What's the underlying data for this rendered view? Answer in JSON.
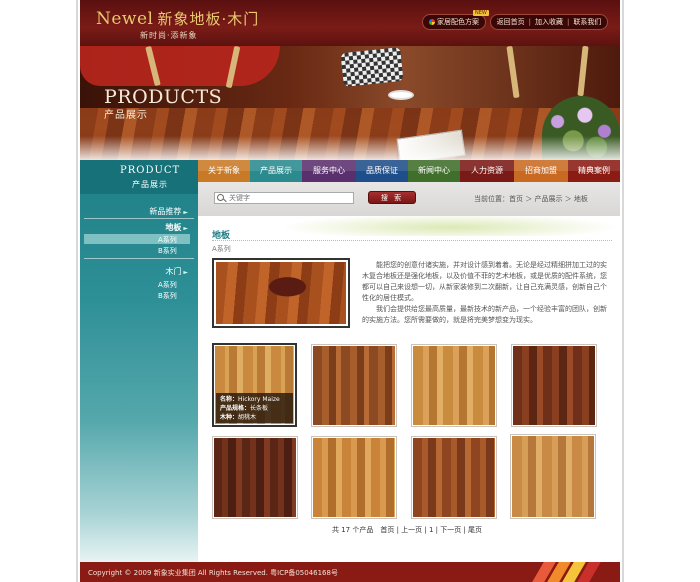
{
  "header": {
    "brand_en": "Newel",
    "brand_cn": "新象地板·木门",
    "slogan": "新时尚·添新象",
    "color_scheme_link": "家居配色方案",
    "new_badge": "NEW",
    "top_links": [
      "返回首页",
      "加入收藏",
      "联系我们"
    ]
  },
  "banner": {
    "title": "PRODUCTS",
    "subtitle": "产品展示"
  },
  "sidebar": {
    "title_en": "PRODUCT",
    "title_cn": "产品展示",
    "recommend": "新品推荐",
    "floor": "地板",
    "floor_series": [
      "A系列",
      "B系列"
    ],
    "door": "木门",
    "door_series": [
      "A系列",
      "B系列"
    ]
  },
  "nav": {
    "items": [
      {
        "label": "关于新象",
        "color": "#c97a26"
      },
      {
        "label": "产品展示",
        "color": "#2a8a8e"
      },
      {
        "label": "服务中心",
        "color": "#5a2f6e"
      },
      {
        "label": "品质保证",
        "color": "#1f4f8a"
      },
      {
        "label": "新闻中心",
        "color": "#3f6f2a"
      },
      {
        "label": "人力资源",
        "color": "#7a1a16"
      },
      {
        "label": "招商加盟",
        "color": "#c96a22"
      },
      {
        "label": "精典案例",
        "color": "#8a1c14"
      }
    ]
  },
  "search": {
    "placeholder": "关键字",
    "button": "搜 索",
    "breadcrumb": "当前位置：首页 ＞ 产品展示 ＞ 地板"
  },
  "content": {
    "section_title": "地板",
    "series": "A系列",
    "intro_p1": "　　能把您的创意付诸实施，并对设计感到着着。无论是经过精细拼加工过的实木复合地板还是强化地板，以及价值不菲的艺术地板，或是优质的配件系统，您都可以自己来设想一切，从新家装修到二次翻新，让自己充满灵感，创新自己个性化的居住模式。",
    "intro_p2": "　　我们会提供给您最高质量，最新技术的新产品，一个经验丰富的团队，创新的实施方法。您所需要做的，就是将完美梦想变为现实。"
  },
  "gallery": {
    "active_info": {
      "name_label": "名称：",
      "name": "Hickory Maize",
      "spec_label": "产品规格：",
      "spec": "长条板",
      "wood_label": "木种：",
      "wood": "胡桃木"
    },
    "pager": "共 17 个产品　首页 | 上一页 | 1 | 下一页 | 尾页"
  },
  "footer": {
    "copyright": "Copyright © 2009 新象实业集团 All Rights Reserved. 粤ICP备05046168号"
  },
  "colors": {
    "header_red": "#7a1b16",
    "teal": "#1f7e86",
    "footer_red": "#8a1a14"
  }
}
